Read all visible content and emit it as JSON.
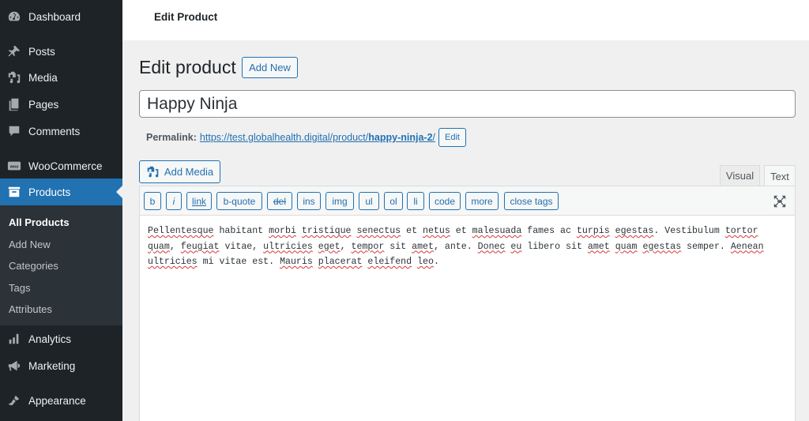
{
  "sidebar": {
    "items": [
      {
        "label": "Dashboard",
        "icon": "dashboard-icon"
      },
      {
        "label": "Posts",
        "icon": "pin-icon"
      },
      {
        "label": "Media",
        "icon": "media-icon"
      },
      {
        "label": "Pages",
        "icon": "pages-icon"
      },
      {
        "label": "Comments",
        "icon": "comment-icon"
      },
      {
        "label": "WooCommerce",
        "icon": "woocommerce-icon"
      },
      {
        "label": "Products",
        "icon": "archive-icon",
        "active": true
      },
      {
        "label": "Analytics",
        "icon": "bar-chart-icon"
      },
      {
        "label": "Marketing",
        "icon": "megaphone-icon"
      },
      {
        "label": "Appearance",
        "icon": "paintbrush-icon"
      }
    ],
    "submenu": [
      {
        "label": "All Products",
        "current": true
      },
      {
        "label": "Add New"
      },
      {
        "label": "Categories"
      },
      {
        "label": "Tags"
      },
      {
        "label": "Attributes"
      }
    ]
  },
  "header": {
    "title": "Edit Product"
  },
  "main": {
    "heading": "Edit product",
    "add_new_label": "Add New",
    "title_value": "Happy Ninja",
    "permalink": {
      "label": "Permalink:",
      "url_base": "https://test.globalhealth.digital/product/",
      "slug": "happy-ninja-2",
      "url_tail": "/",
      "edit_label": "Edit"
    },
    "add_media_label": "Add Media",
    "tabs": {
      "visual": "Visual",
      "text": "Text",
      "active": "Text"
    },
    "quicktags": [
      "b",
      "i",
      "link",
      "b-quote",
      "del",
      "ins",
      "img",
      "ul",
      "ol",
      "li",
      "code",
      "more",
      "close tags"
    ],
    "content_lines": [
      "Pellentesque habitant morbi tristique senectus et netus et malesuada fames ac turpis egestas. Vestibulum tortor",
      "quam, feugiat vitae, ultricies eget, tempor sit amet, ante. Donec eu libero sit amet quam egestas semper. Aenean",
      "ultricies mi vitae est. Mauris placerat eleifend leo."
    ],
    "misspelled": [
      "Pellentesque",
      "morbi",
      "tristique",
      "senectus",
      "netus",
      "malesuada",
      "turpis",
      "egestas",
      "tortor",
      "quam",
      "feugiat",
      "ultricies",
      "eget",
      "tempor",
      "amet",
      "Donec",
      "eu",
      "Aenean",
      "Mauris",
      "placerat",
      "eleifend",
      "leo"
    ]
  },
  "colors": {
    "accent": "#2271b1",
    "sidebar_bg": "#1d2327",
    "submenu_bg": "#2c3338",
    "spellcheck": "#d63638"
  }
}
